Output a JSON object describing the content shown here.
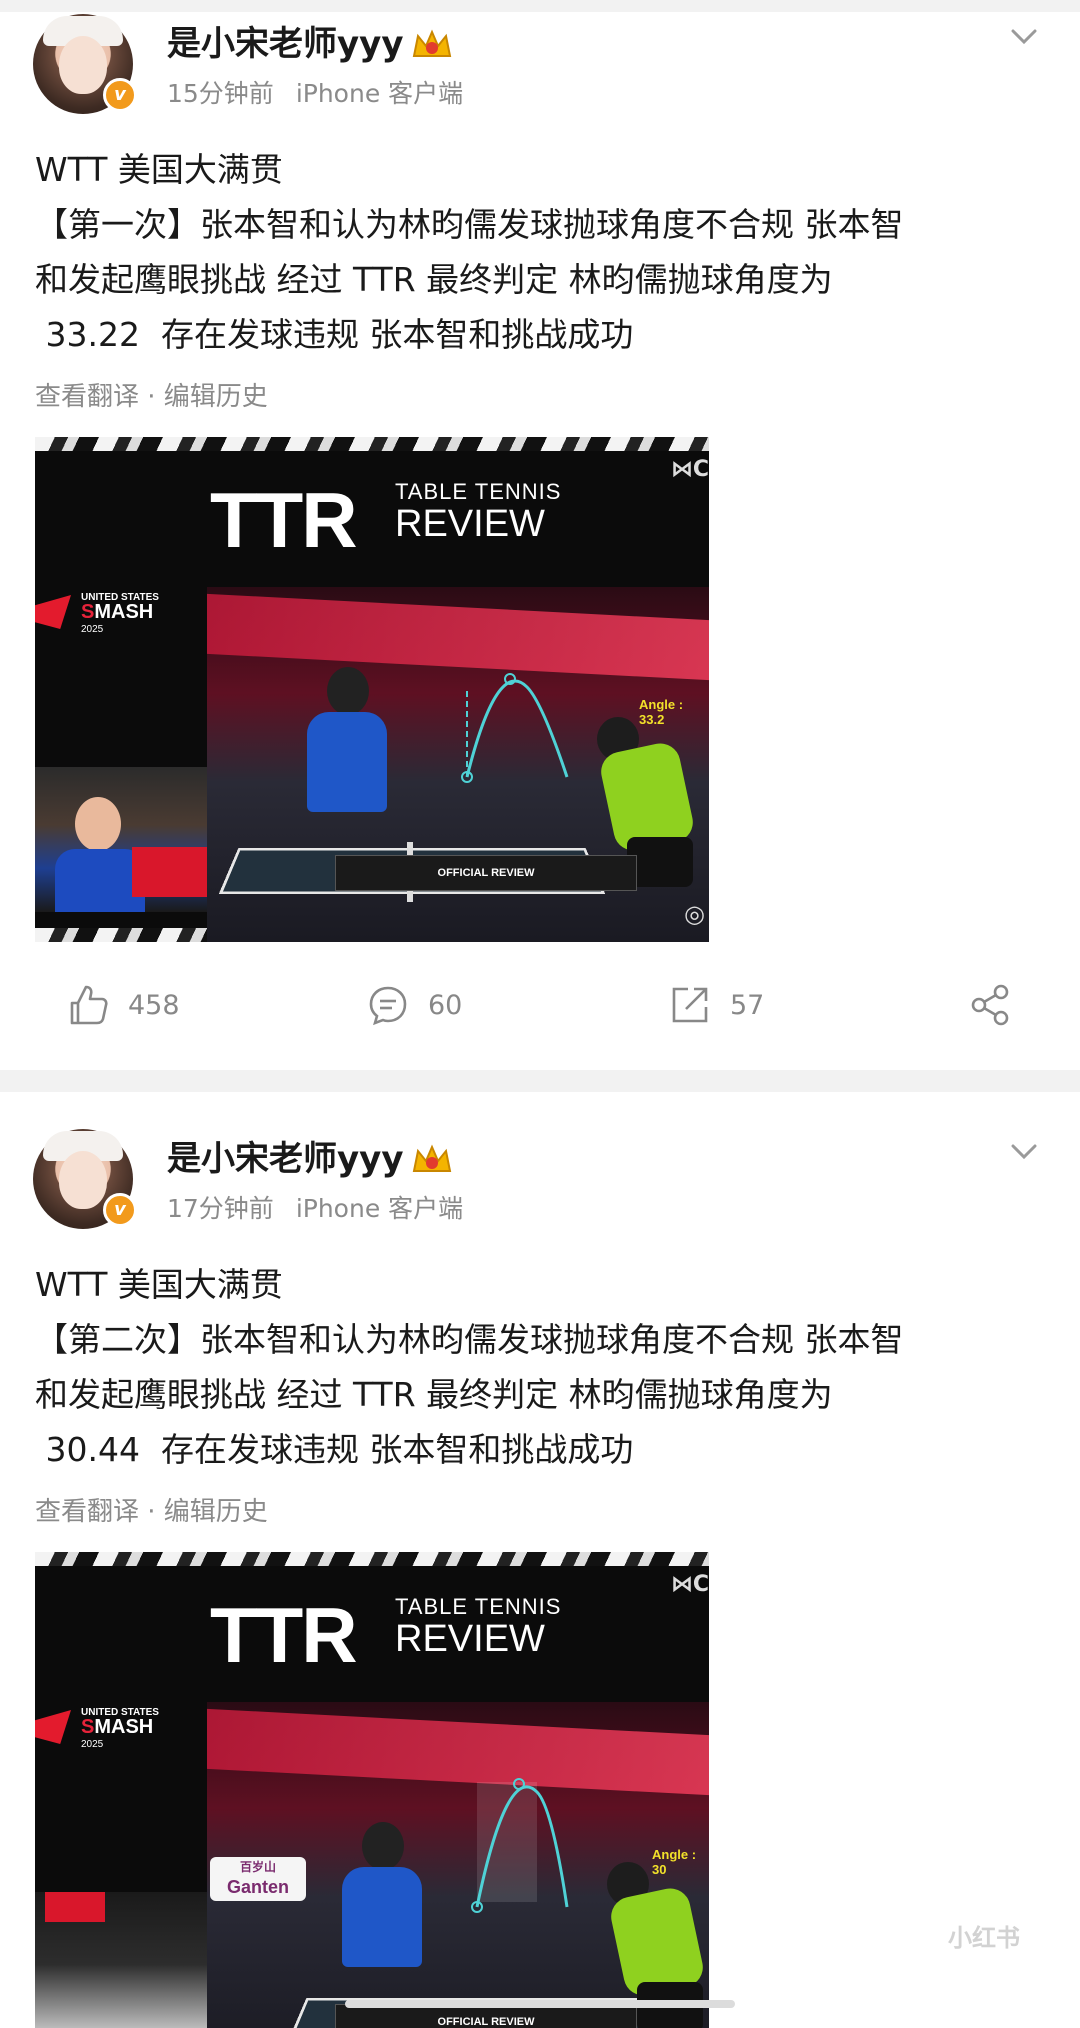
{
  "posts": [
    {
      "username": "是小宋老师yyy",
      "time": "15分钟前",
      "client": "iPhone 客户端",
      "lines": [
        "WTT 美国大满贯",
        "【第一次】张本智和认为林昀儒发球抛球角度不合规 张本智",
        "和发起鹰眼挑战 经过 TTR 最终判定 林昀儒抛球角度为",
        " 33.22  存在发球违规 张本智和挑战成功"
      ],
      "links": "查看翻译 · 编辑历史",
      "video": {
        "logo": "TTR",
        "sub1": "TABLE TENNIS",
        "sub2": "REVIEW",
        "brand1": "UNITED STATES",
        "brand2a": "S",
        "brand2b": "MASH",
        "brand3": "2025",
        "badge": "OFFICIAL REVIEW",
        "angle": "Angle : 33.2"
      },
      "likes": "458",
      "comments": "60",
      "reposts": "57"
    },
    {
      "username": "是小宋老师yyy",
      "time": "17分钟前",
      "client": "iPhone 客户端",
      "lines": [
        "WTT 美国大满贯",
        "【第二次】张本智和认为林昀儒发球抛球角度不合规 张本智",
        "和发起鹰眼挑战 经过 TTR 最终判定 林昀儒抛球角度为",
        " 30.44  存在发球违规 张本智和挑战成功"
      ],
      "links": "查看翻译 · 编辑历史",
      "video": {
        "logo": "TTR",
        "sub1": "TABLE TENNIS",
        "sub2": "REVIEW",
        "brand1": "UNITED STATES",
        "brand2a": "S",
        "brand2b": "MASH",
        "brand3": "2025",
        "badge": "OFFICIAL REVIEW",
        "angle": "Angle : 30",
        "sponsor1": "百岁山",
        "sponsor2": "Ganten"
      }
    }
  ],
  "watermark": "小红书",
  "colors": {
    "verified_badge": "#f29a1c",
    "text": "#1a1a1a",
    "meta": "#8a8a8a",
    "separator": "#f2f2f2"
  }
}
